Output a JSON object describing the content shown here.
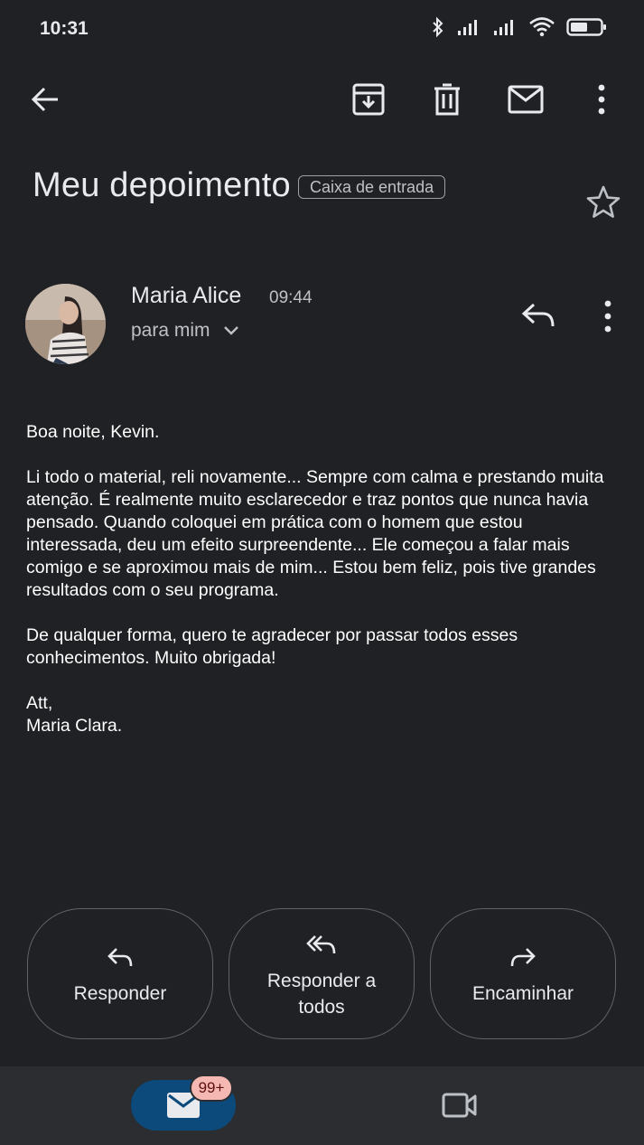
{
  "status_bar": {
    "time": "10:31",
    "icons": [
      "bluetooth-icon",
      "signal-icon",
      "signal-icon",
      "wifi-icon",
      "battery-icon"
    ]
  },
  "toolbar": {
    "icons": [
      "back-arrow-icon",
      "archive-icon",
      "delete-icon",
      "mark-unread-icon",
      "more-vert-icon"
    ]
  },
  "email": {
    "subject": "Meu depoimento",
    "label": "Caixa de entrada",
    "sender_name": "Maria Alice",
    "time": "09:44",
    "recipient": "para mim",
    "body": [
      "Boa noite, Kevin.",
      "Li todo o material, reli novamente... Sempre com calma e prestando muita atenção. É realmente muito esclarecedor e traz pontos que nunca havia pensado. Quando coloquei em prática com o homem que estou interessada, deu um efeito surpreendente... Ele começou a falar mais comigo e se aproximou mais de mim... Estou bem feliz, pois tive grandes resultados com o seu programa.",
      "De qualquer forma, quero te agradecer por passar todos esses conhecimentos. Muito obrigada!",
      "Att,\nMaria Clara."
    ]
  },
  "actions": {
    "reply": "Responder",
    "reply_all": "Responder a todos",
    "forward": "Encaminhar"
  },
  "bottom_nav": {
    "mail_badge": "99+",
    "icons": [
      "mail-icon",
      "video-icon"
    ]
  },
  "colors": {
    "background": "#202124",
    "nav_background": "#2b2d31",
    "mail_pill": "#0b4a7a",
    "badge": "#f6b8b3"
  }
}
